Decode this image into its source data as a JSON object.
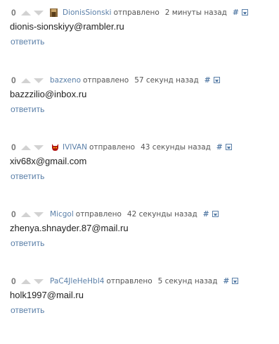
{
  "labels": {
    "sent": "отправлено",
    "reply": "ответить",
    "hash": "#",
    "save_icon": "save-icon"
  },
  "comments": [
    {
      "score": "0",
      "author": "DionisSionski",
      "avatar": "wooden-figure-avatar",
      "time": "2 минуты назад",
      "text": "dionis-sionskiyy@rambler.ru"
    },
    {
      "score": "0",
      "author": "bazxeno",
      "avatar": "",
      "time": "57 секунд назад",
      "text": "bazzzilio@inbox.ru"
    },
    {
      "score": "0",
      "author": "IVIVAN",
      "avatar": "red-devil-avatar",
      "time": "43 секунды назад",
      "text": "xiv68x@gmail.com"
    },
    {
      "score": "0",
      "author": "Micgol",
      "avatar": "",
      "time": "42 секунды назад",
      "text": "zhenya.shnayder.87@mail.ru"
    },
    {
      "score": "0",
      "author": "PaC4JleHeHbI4",
      "avatar": "",
      "time": "5 секунд назад",
      "text": "holk1997@mail.ru"
    }
  ]
}
